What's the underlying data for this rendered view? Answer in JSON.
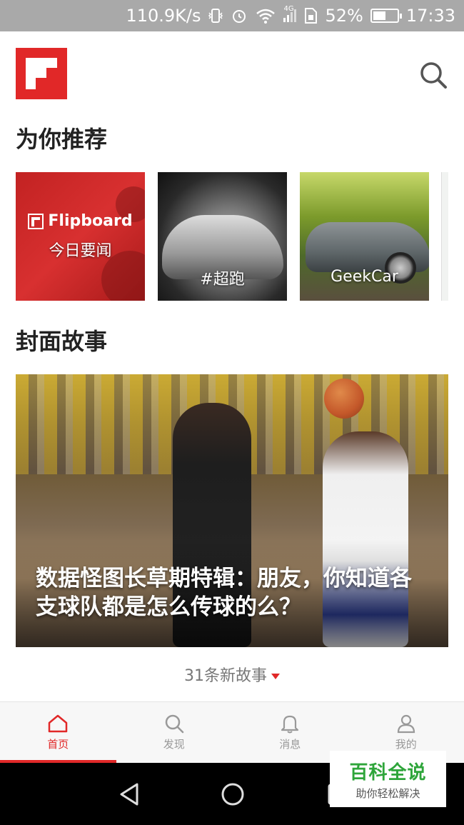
{
  "status_bar": {
    "net_speed": "110.9K/s",
    "network_type": "4G",
    "battery": "52%",
    "battery_level": 0.52,
    "time": "17:33",
    "icons": [
      "vibrate-icon",
      "alarm-icon",
      "wifi-icon",
      "signal-icon",
      "sim-icon",
      "battery-icon"
    ]
  },
  "header": {
    "logo": "flipboard-logo",
    "search_icon": "search-icon"
  },
  "recommend": {
    "title": "为你推荐",
    "cards": [
      {
        "brand": "Flipboard",
        "label": "今日要闻"
      },
      {
        "label": "#超跑"
      },
      {
        "label": "GeekCar"
      }
    ]
  },
  "cover_story": {
    "title": "封面故事",
    "headline": "数据怪图长草期特辑：朋友，你知道各支球队都是怎么传球的么？"
  },
  "more_stories": "31条新故事",
  "tabs": [
    {
      "label": "首页",
      "icon": "home-icon",
      "active": true
    },
    {
      "label": "发现",
      "icon": "search-icon",
      "active": false
    },
    {
      "label": "消息",
      "icon": "bell-icon",
      "active": false
    },
    {
      "label": "我的",
      "icon": "user-icon",
      "active": false
    }
  ],
  "nav": [
    "back-icon",
    "home-circle-icon",
    "recents-icon"
  ],
  "watermark": {
    "line1": "百科全说",
    "line2": "助你轻松解决"
  },
  "colors": {
    "accent": "#e12828",
    "tab_inactive": "#999999",
    "status_bar": "#a9a9a9"
  }
}
